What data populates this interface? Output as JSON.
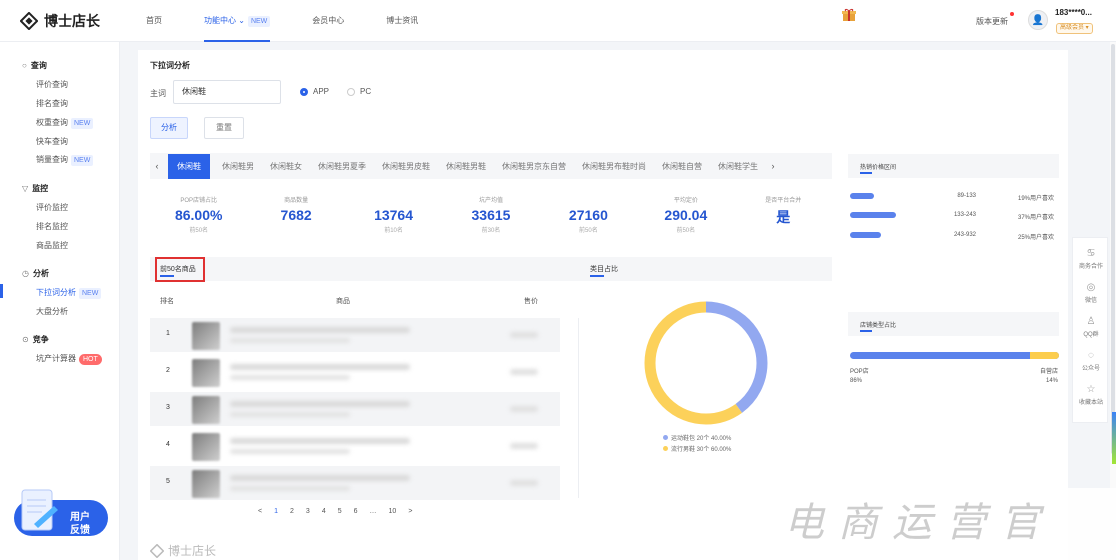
{
  "app": {
    "logo_text": "博士店长"
  },
  "nav": {
    "items": [
      {
        "label": "首页"
      },
      {
        "label": "功能中心 ⌄",
        "tag": "NEW"
      },
      {
        "label": "会员中心"
      },
      {
        "label": "博士资讯"
      }
    ]
  },
  "header": {
    "version_label": "版本更新",
    "user_phone": "183****0...",
    "vip_label": "高级会员 ▾"
  },
  "sidebar": {
    "groups": [
      {
        "label": "查询",
        "icon": "○",
        "items": [
          {
            "label": "评价查询"
          },
          {
            "label": "排名查询"
          },
          {
            "label": "权重查询",
            "tag": "NEW"
          },
          {
            "label": "快车查询"
          },
          {
            "label": "销量查询",
            "tag": "NEW"
          }
        ]
      },
      {
        "label": "监控",
        "icon": "▽",
        "items": [
          {
            "label": "评价监控"
          },
          {
            "label": "排名监控"
          },
          {
            "label": "商品监控"
          }
        ]
      },
      {
        "label": "分析",
        "icon": "◷",
        "items": [
          {
            "label": "下拉词分析",
            "tag": "NEW"
          },
          {
            "label": "大盘分析"
          }
        ]
      },
      {
        "label": "竞争",
        "icon": "⊙",
        "items": [
          {
            "label": "坑产计算器",
            "tag": "HOT"
          }
        ]
      }
    ],
    "feedback": {
      "line1": "用户",
      "line2": "反馈"
    }
  },
  "main": {
    "title": "下拉词分析",
    "keyword_label": "主词",
    "keyword_value": "休闲鞋",
    "platform_app": "APP",
    "platform_pc": "PC",
    "analyze_button": "分析",
    "reset_button": "重置",
    "tabs": [
      "休闲鞋",
      "休闲鞋男",
      "休闲鞋女",
      "休闲鞋男夏季",
      "休闲鞋男皮鞋",
      "休闲鞋男鞋",
      "休闲鞋男京东自营",
      "休闲鞋男布鞋时尚",
      "休闲鞋自营",
      "休闲鞋学生"
    ],
    "stats": [
      {
        "label": "POP店铺占比",
        "value": "86.00%",
        "sub": "前50名"
      },
      {
        "label": "商品数量",
        "value": "7682",
        "sub": ""
      },
      {
        "label": "",
        "value": "13764",
        "sub": "前10名"
      },
      {
        "label": "坑产均值",
        "value": "33615",
        "sub": "前30名"
      },
      {
        "label": "",
        "value": "27160",
        "sub": "前50名"
      },
      {
        "label": "平均定价",
        "value": "290.04",
        "sub": "前50名"
      },
      {
        "label": "是否平台合并",
        "value": "是",
        "sub": ""
      }
    ],
    "subtab_left": "前50名商品",
    "subtab_right": "类目占比",
    "table_headers": {
      "rank": "排名",
      "product": "商品",
      "price": "售价"
    },
    "rows": [
      {
        "rank": "1"
      },
      {
        "rank": "2"
      },
      {
        "rank": "3"
      },
      {
        "rank": "4"
      },
      {
        "rank": "5"
      }
    ],
    "pagination": [
      "<",
      "1",
      "2",
      "3",
      "4",
      "5",
      "6",
      "…",
      "10",
      ">"
    ],
    "footer_logo": "博士店长"
  },
  "chart_data": {
    "type": "pie",
    "categories": [
      "运动鞋包",
      "流行男鞋"
    ],
    "values": [
      20,
      30
    ],
    "percentages": [
      40.0,
      60.0
    ],
    "colors": [
      "#92a8f0",
      "#fcd15a"
    ],
    "legend": [
      "运动鞋包 20个 40.00%",
      "流行男鞋 30个 60.00%"
    ]
  },
  "price_panel": {
    "title": "热销价格区间",
    "rows": [
      {
        "range": "89-133",
        "pct_label": "19%用户喜欢",
        "share": 0.19
      },
      {
        "range": "133-243",
        "pct_label": "37%用户喜欢",
        "share": 0.37
      },
      {
        "range": "243-932",
        "pct_label": "25%用户喜欢",
        "share": 0.25
      }
    ]
  },
  "shop_panel": {
    "title": "店铺类型占比",
    "pop_label": "POP店",
    "pop_pct": "86%",
    "self_label": "自营店",
    "self_pct": "14%",
    "pop_share": 0.86
  },
  "float_panel": {
    "items": [
      {
        "label": "商务合作",
        "icon": "♋"
      },
      {
        "label": "微信",
        "icon": "◎"
      },
      {
        "label": "QQ群",
        "icon": "♙"
      },
      {
        "label": "公众号",
        "icon": "◌"
      },
      {
        "label": "收藏本站",
        "icon": "☆"
      }
    ]
  },
  "watermark": "电商运营官",
  "colors": {
    "accent": "#2b62e8",
    "stat_value": "#2556d0",
    "highlight_box": "#e03131"
  }
}
